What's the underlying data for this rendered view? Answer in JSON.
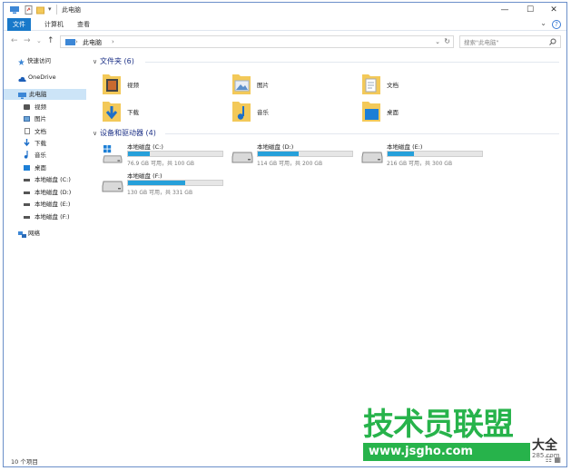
{
  "window": {
    "title": "此电脑",
    "quick_access_dropdown": "▾",
    "controls": {
      "minimize": "—",
      "maximize": "☐",
      "close": "✕"
    }
  },
  "ribbon": {
    "tabs": [
      {
        "label": "文件",
        "active": true
      },
      {
        "label": "计算机",
        "active": false
      },
      {
        "label": "查看",
        "active": false
      }
    ],
    "expand": "⌄",
    "help": "?"
  },
  "navigation": {
    "back": "←",
    "forward": "→",
    "recent": "⌄",
    "up": "↑",
    "address": {
      "location": "此电脑",
      "separator": "›",
      "trailing": "›",
      "dropdown": "⌄",
      "refresh": "↻"
    },
    "search": {
      "placeholder": "搜索\"此电脑\"",
      "icon": "search-icon"
    }
  },
  "sidebar": {
    "items": [
      {
        "label": "快速访问",
        "icon": "star-icon",
        "level": 0,
        "selected": false
      },
      {
        "label": "OneDrive",
        "icon": "cloud-icon",
        "level": 0,
        "selected": false
      },
      {
        "label": "此电脑",
        "icon": "computer-icon",
        "level": 0,
        "selected": true
      },
      {
        "label": "视频",
        "icon": "video-folder-icon",
        "level": 1,
        "selected": false
      },
      {
        "label": "图片",
        "icon": "pictures-folder-icon",
        "level": 1,
        "selected": false
      },
      {
        "label": "文档",
        "icon": "documents-folder-icon",
        "level": 1,
        "selected": false
      },
      {
        "label": "下载",
        "icon": "download-icon",
        "level": 1,
        "selected": false
      },
      {
        "label": "音乐",
        "icon": "music-icon",
        "level": 1,
        "selected": false
      },
      {
        "label": "桌面",
        "icon": "desktop-folder-icon",
        "level": 1,
        "selected": false
      },
      {
        "label": "本地磁盘 (C:)",
        "icon": "drive-icon",
        "level": 1,
        "selected": false
      },
      {
        "label": "本地磁盘 (D:)",
        "icon": "drive-icon",
        "level": 1,
        "selected": false
      },
      {
        "label": "本地磁盘 (E:)",
        "icon": "drive-icon",
        "level": 1,
        "selected": false
      },
      {
        "label": "本地磁盘 (F:)",
        "icon": "drive-icon",
        "level": 1,
        "selected": false
      },
      {
        "label": "网络",
        "icon": "network-icon",
        "level": 0,
        "selected": false
      }
    ]
  },
  "folders_group": {
    "header": "文件夹 (6)",
    "chevron": "∨",
    "items": [
      {
        "label": "视频",
        "icon": "video-folder-icon"
      },
      {
        "label": "图片",
        "icon": "pictures-folder-icon"
      },
      {
        "label": "文档",
        "icon": "documents-folder-icon"
      },
      {
        "label": "下载",
        "icon": "downloads-folder-icon"
      },
      {
        "label": "音乐",
        "icon": "music-folder-icon"
      },
      {
        "label": "桌面",
        "icon": "desktop-folder-icon"
      }
    ]
  },
  "drives_group": {
    "header": "设备和驱动器 (4)",
    "chevron": "∨",
    "items": [
      {
        "label": "本地磁盘 (C:)",
        "info": "76.9 GB 可用，共 100 GB",
        "used_fraction": 0.23,
        "windows": true
      },
      {
        "label": "本地磁盘 (D:)",
        "info": "114 GB 可用，共 200 GB",
        "used_fraction": 0.43,
        "windows": false
      },
      {
        "label": "本地磁盘 (E:)",
        "info": "216 GB 可用，共 300 GB",
        "used_fraction": 0.28,
        "windows": false
      },
      {
        "label": "本地磁盘 (F:)",
        "info": "130 GB 可用，共 331 GB",
        "used_fraction": 0.61,
        "windows": false
      }
    ]
  },
  "status_bar": {
    "item_count": "10 个项目",
    "views": "☷ ▦"
  },
  "watermark": {
    "line1": "技术员联盟",
    "line2": "www.jsgho.com",
    "side1": "大全",
    "side2": "285.com"
  },
  "colors": {
    "accent": "#1979ca",
    "selection": "#cce4f7",
    "progress": "#26a0da",
    "group_header": "#1e3287",
    "watermark": "#27b34b"
  }
}
